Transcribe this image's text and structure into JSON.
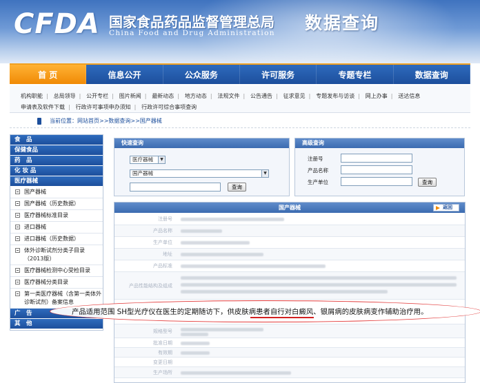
{
  "header": {
    "logo": "CFDA",
    "org_cn": "国家食品药品监督管理总局",
    "org_en": "China Food and Drug Administration",
    "section": "数据查询"
  },
  "nav": {
    "items": [
      "首 页",
      "信息公开",
      "公众服务",
      "许可服务",
      "专题专栏",
      "数据查询"
    ]
  },
  "subnav": {
    "row1": [
      "机构职能",
      "总局领导",
      "公开专栏",
      "图片新闻",
      "最新动态",
      "地方动态",
      "法规文件",
      "公告通告",
      "征求意见",
      "专题发布与访谈",
      "网上办事",
      "送达信息"
    ],
    "row2": [
      "申请表及软件下载",
      "行政许可事项申办须知",
      "行政许可综合事项查询"
    ]
  },
  "breadcrumb": "当前位置：网站首页>>数据查询>>国产器械",
  "sidebar": {
    "cats_top": [
      "食　品",
      "保健食品",
      "药　品",
      "化 妆 品",
      "医疗器械"
    ],
    "items": [
      "国产器械",
      "国产器械（历史数据）",
      "医疗器械标准目录",
      "进口器械",
      "进口器械（历史数据）",
      "体外诊断试剂分类子目录（2013版）",
      "医疗器械检测中心受检目录",
      "医疗器械分类目录",
      "第一类医疗器械（含第一类体外诊断试剂）备案信息"
    ],
    "cats_bottom": [
      "广　告",
      "其　他"
    ]
  },
  "quick": {
    "title": "快速查询",
    "select1": "医疗器械",
    "select2": "国产器械",
    "button": "查询"
  },
  "advanced": {
    "title": "高级查询",
    "labels": [
      "注册号",
      "产品名称",
      "生产单位"
    ],
    "button": "查询"
  },
  "result": {
    "title": "国产器械",
    "back": "返回",
    "field_labels": [
      "注册号",
      "产品名称",
      "生产单位",
      "地址",
      "产品标准",
      "产品性能结构及组成"
    ],
    "lower_labels": [
      "规格型号",
      "批准日期",
      "有效期",
      "变更日期",
      "生产场所"
    ]
  },
  "annotation": {
    "pre": "产品适用范围 SH型光疗仪在医生的定期随访下，",
    "highlight": "供皮肤病患者自行",
    "post": "对白癜风、银屑病的皮肤病变作辅助治疗用。"
  }
}
